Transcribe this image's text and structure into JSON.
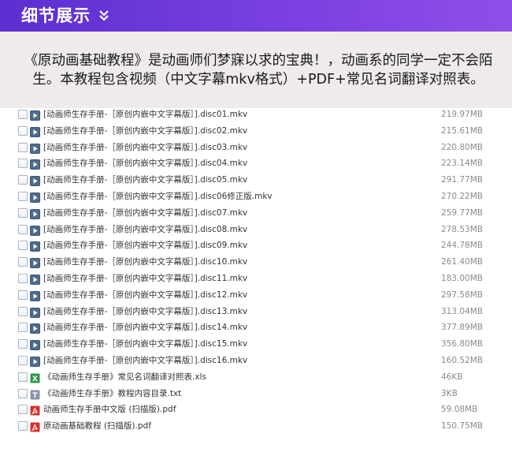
{
  "header": {
    "title": "细节展示",
    "accent_color": "#6a37d8",
    "chevron_icon": "double-chevron-down-icon"
  },
  "intro": {
    "text": "《原动画基础教程》是动画师们梦寐以求的宝典！，动画系的同学一定不会陌生。本教程包含视频（中文字幕mkv格式）+PDF+常见名词翻译对照表。"
  },
  "files": [
    {
      "name": "[动画师生存手册-［原创内嵌中文字幕版］].disc01.mkv",
      "size": "219.97MB",
      "type": "video"
    },
    {
      "name": "[动画师生存手册-［原创内嵌中文字幕版］].disc02.mkv",
      "size": "215.61MB",
      "type": "video"
    },
    {
      "name": "[动画师生存手册-［原创内嵌中文字幕版］].disc03.mkv",
      "size": "220.80MB",
      "type": "video"
    },
    {
      "name": "[动画师生存手册-［原创内嵌中文字幕版］].disc04.mkv",
      "size": "223.14MB",
      "type": "video"
    },
    {
      "name": "[动画师生存手册-［原创内嵌中文字幕版］].disc05.mkv",
      "size": "291.77MB",
      "type": "video"
    },
    {
      "name": "[动画师生存手册-［原创内嵌中文字幕版］].disc06修正版.mkv",
      "size": "270.22MB",
      "type": "video"
    },
    {
      "name": "[动画师生存手册-［原创内嵌中文字幕版］].disc07.mkv",
      "size": "259.77MB",
      "type": "video"
    },
    {
      "name": "[动画师生存手册-［原创内嵌中文字幕版］].disc08.mkv",
      "size": "278.53MB",
      "type": "video"
    },
    {
      "name": "[动画师生存手册-［原创内嵌中文字幕版］].disc09.mkv",
      "size": "244.78MB",
      "type": "video"
    },
    {
      "name": "[动画师生存手册-［原创内嵌中文字幕版］].disc10.mkv",
      "size": "261.40MB",
      "type": "video"
    },
    {
      "name": "[动画师生存手册-［原创内嵌中文字幕版］].disc11.mkv",
      "size": "183.00MB",
      "type": "video"
    },
    {
      "name": "[动画师生存手册-［原创内嵌中文字幕版］].disc12.mkv",
      "size": "297.58MB",
      "type": "video"
    },
    {
      "name": "[动画师生存手册-［原创内嵌中文字幕版］].disc13.mkv",
      "size": "313.04MB",
      "type": "video"
    },
    {
      "name": "[动画师生存手册-［原创内嵌中文字幕版］].disc14.mkv",
      "size": "377.89MB",
      "type": "video"
    },
    {
      "name": "[动画师生存手册-［原创内嵌中文字幕版］].disc15.mkv",
      "size": "356.80MB",
      "type": "video"
    },
    {
      "name": "[动画师生存手册-［原创内嵌中文字幕版］].disc16.mkv",
      "size": "160.52MB",
      "type": "video"
    },
    {
      "name": "《动画师生存手册》常见名词翻译对照表.xls",
      "size": "46KB",
      "type": "excel"
    },
    {
      "name": "《动画师生存手册》教程内容目录.txt",
      "size": "3KB",
      "type": "text"
    },
    {
      "name": "动画师生存手册中文版 (扫描版).pdf",
      "size": "59.08MB",
      "type": "pdf"
    },
    {
      "name": "原动画基础教程 (扫描版).pdf",
      "size": "150.75MB",
      "type": "pdf"
    }
  ]
}
